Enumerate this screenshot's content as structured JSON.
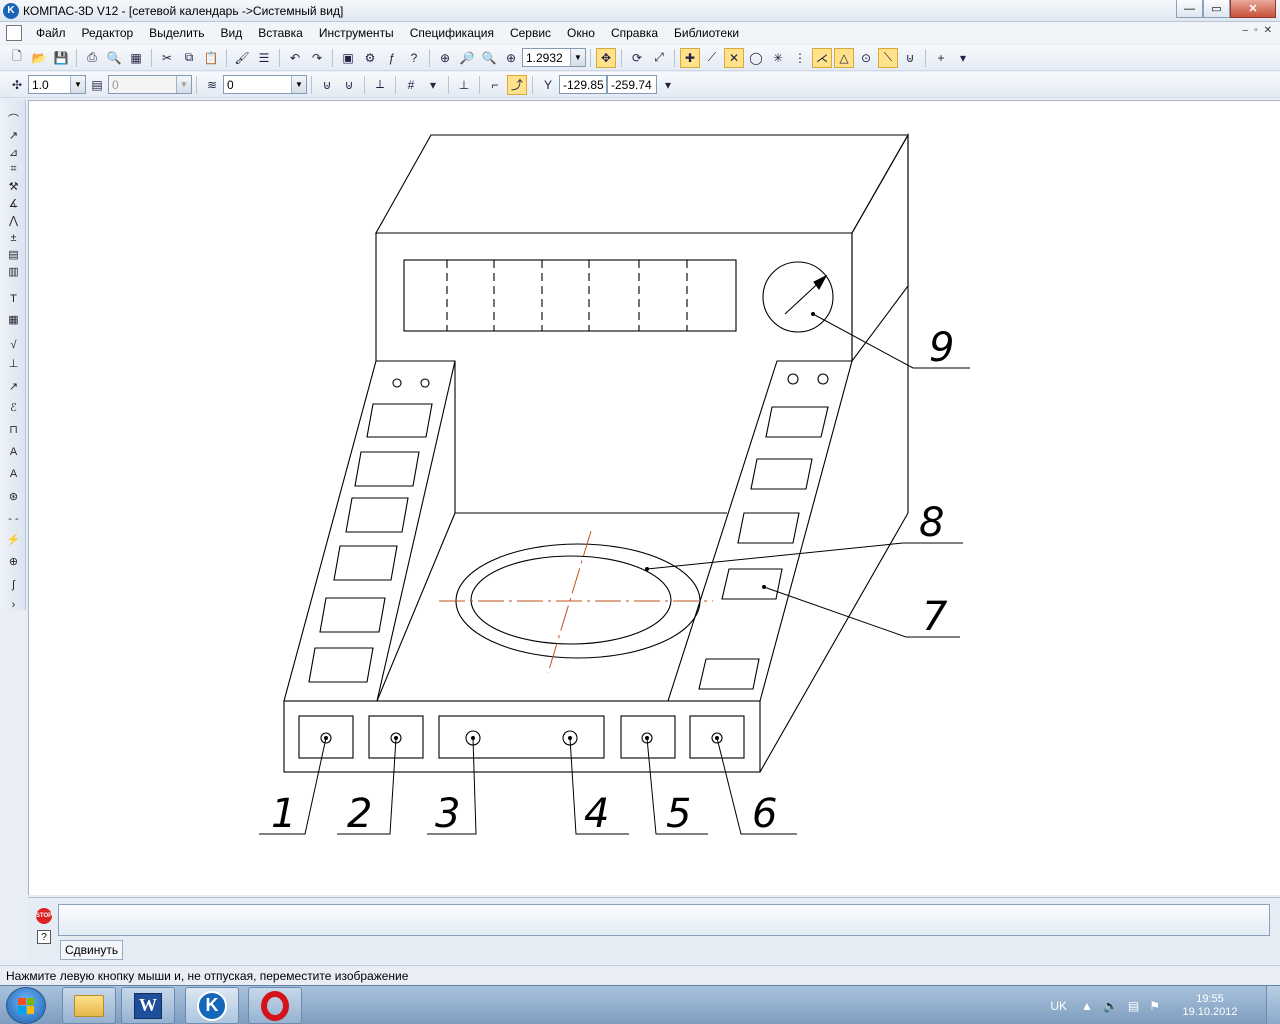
{
  "window": {
    "title": "КОМПАС-3D V12 - [сетевой календарь ->Системный вид]",
    "minimize": "—",
    "maximize": "▭",
    "close": "✕"
  },
  "menu": {
    "items": [
      "Файл",
      "Редактор",
      "Выделить",
      "Вид",
      "Вставка",
      "Инструменты",
      "Спецификация",
      "Сервис",
      "Окно",
      "Справка",
      "Библиотеки"
    ],
    "mdi_controls": [
      "–",
      "▫",
      "✕"
    ]
  },
  "toolbar1": {
    "zoom_value": "1.2932"
  },
  "toolbar2": {
    "step_value": "1.0",
    "style_value": "0",
    "layer_value": "0",
    "x_coord": "-129.85",
    "y_coord": "-259.74"
  },
  "drawing": {
    "callout_labels": [
      "1",
      "2",
      "3",
      "4",
      "5",
      "6",
      "7",
      "8",
      "9"
    ]
  },
  "command_panel": {
    "stop_icon_text": "STOP",
    "help_icon_text": "?",
    "tab_label": "Сдвинуть"
  },
  "status_bar": {
    "hint": "Нажмите левую кнопку мыши и, не отпуская, переместите изображение"
  },
  "taskbar": {
    "word_letter": "W",
    "kompas_letter": "K",
    "language": "UK",
    "time": "19:55",
    "date": "19.10.2012"
  },
  "colors": {
    "centerline": "#c0501a",
    "highlight": "#ffe28a",
    "close_button": "#c7503a"
  }
}
